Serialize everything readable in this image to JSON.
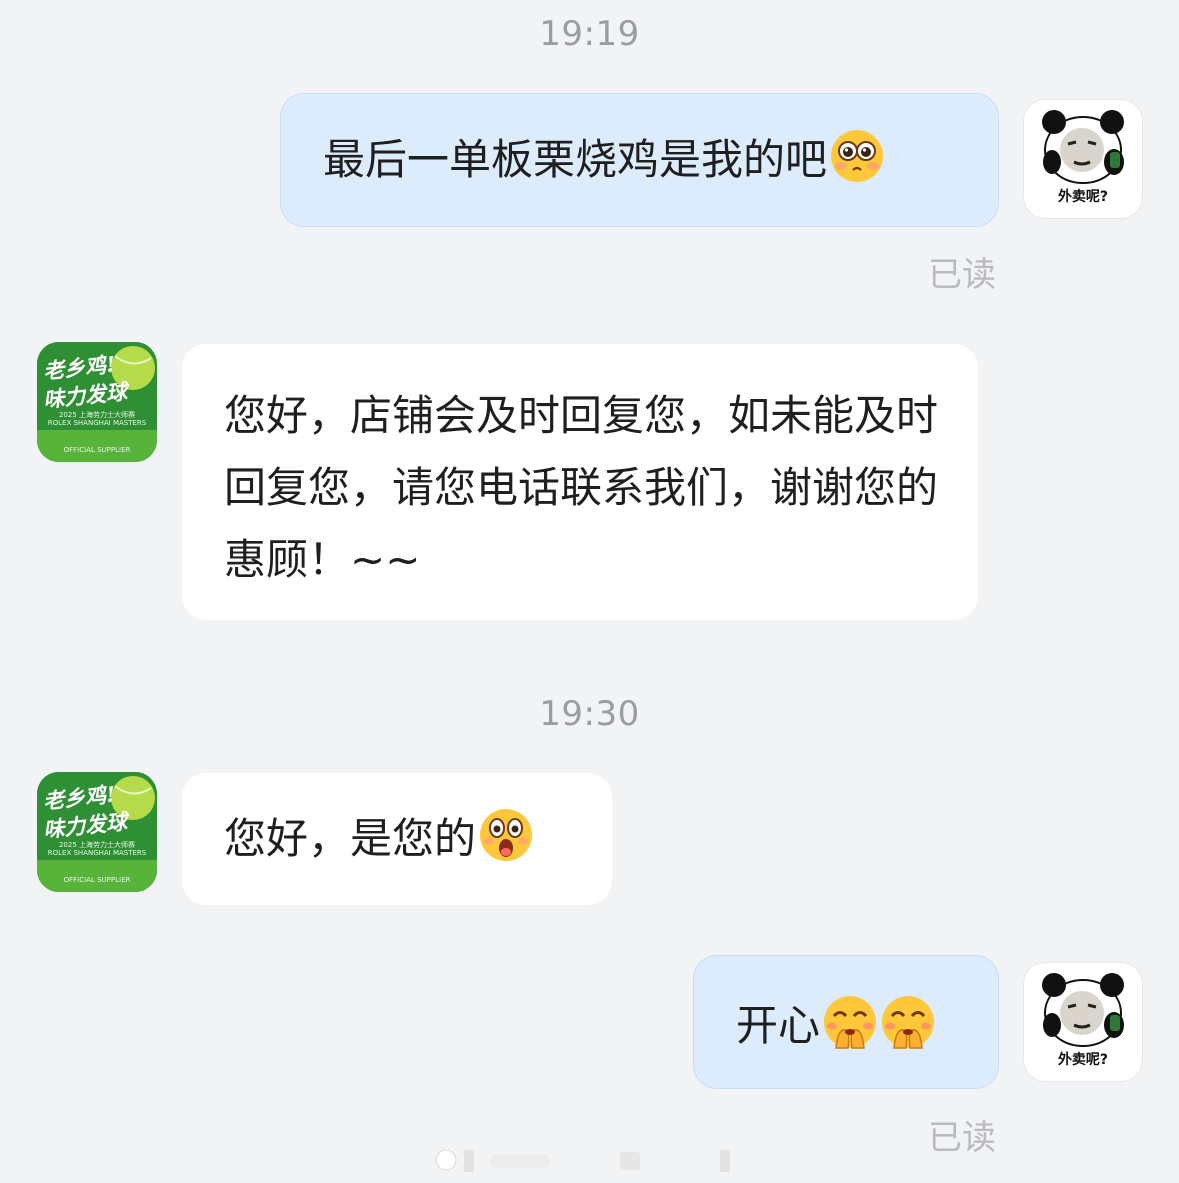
{
  "timestamps": [
    "19:19",
    "19:30"
  ],
  "messages": [
    {
      "text": "最后一单板栗烧鸡是我的吧",
      "emoji": "pleading-face"
    },
    {
      "text": "您好，店铺会及时回复您，如未能及时回复您，请您电话联系我们，谢谢您的惠顾！~~"
    },
    {
      "text": "您好，是您的",
      "emoji": "astonished-face"
    },
    {
      "text": "开心",
      "emoji": "face-with-hand-over-mouth"
    }
  ],
  "read_status": "已读",
  "user_avatar": {
    "caption": "外卖呢?"
  },
  "shop_avatar": {
    "line1": "老乡鸡!",
    "line2": "味力发球",
    "line3": "2025 上海劳力士大师赛",
    "line4": "ROLEX SHANGHAI MASTERS",
    "line5": "OFFICIAL SUPPLIER",
    "brand_color": "#2f8f34"
  },
  "colors": {
    "outgoing_bubble": "#dcecfd",
    "incoming_bubble": "#ffffff",
    "background": "#f2f3f5"
  }
}
